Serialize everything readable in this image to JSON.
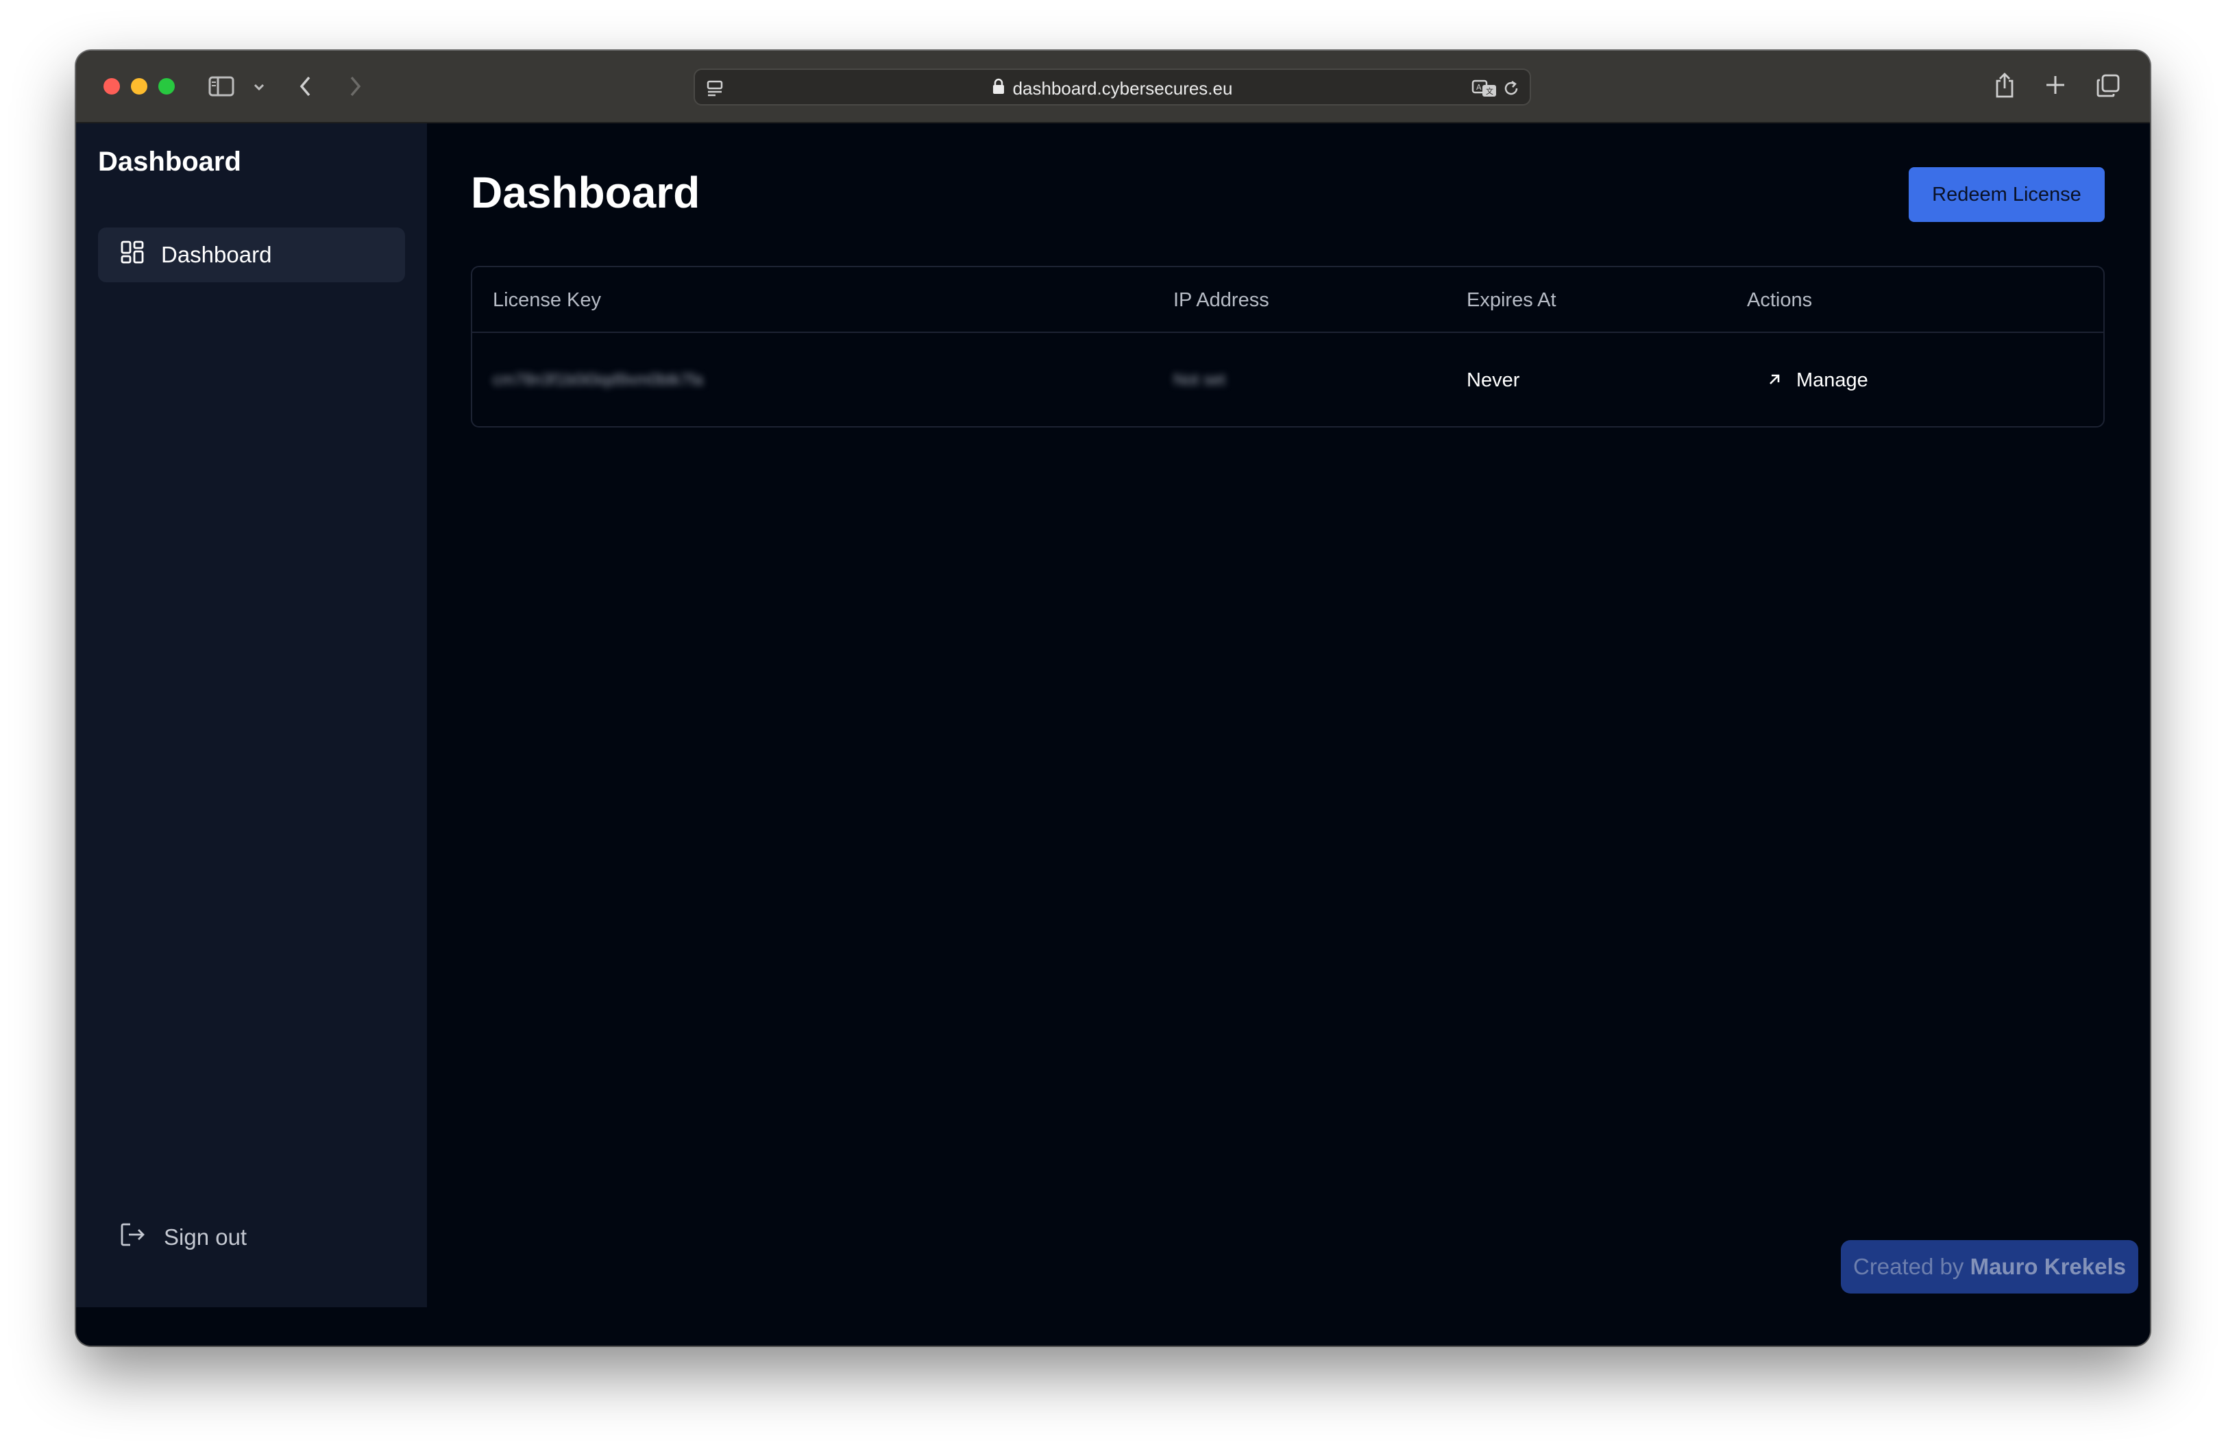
{
  "browser": {
    "url": "dashboard.cybersecures.eu",
    "icons": [
      "sidebar-toggle-icon",
      "chevron-down-icon",
      "back-icon",
      "forward-icon",
      "page-menu-icon",
      "lock-icon",
      "translate-icon",
      "reload-icon",
      "share-icon",
      "new-tab-icon",
      "tab-overview-icon"
    ]
  },
  "sidebar": {
    "title": "Dashboard",
    "items": [
      {
        "label": "Dashboard",
        "icon": "dashboard-grid-icon",
        "active": true
      }
    ],
    "signout_label": "Sign out",
    "signout_icon": "sign-out-icon"
  },
  "main": {
    "title": "Dashboard",
    "redeem_label": "Redeem License",
    "table": {
      "headers": [
        "License Key",
        "IP Address",
        "Expires At",
        "Actions"
      ],
      "rows": [
        {
          "license_key": "cm78n3f1b0i0iqd9xm0btk7fa",
          "ip_address": "Not set",
          "expires_at": "Never",
          "action_label": "Manage",
          "action_icon": "arrow-up-right-icon"
        }
      ]
    }
  },
  "credit": {
    "prefix": "Created by ",
    "author": "Mauro Krekels"
  },
  "colors": {
    "accent": "#3b6fe8",
    "background": "#010610",
    "sidebar": "#0f1626",
    "credit_badge": "#1e3a86"
  }
}
